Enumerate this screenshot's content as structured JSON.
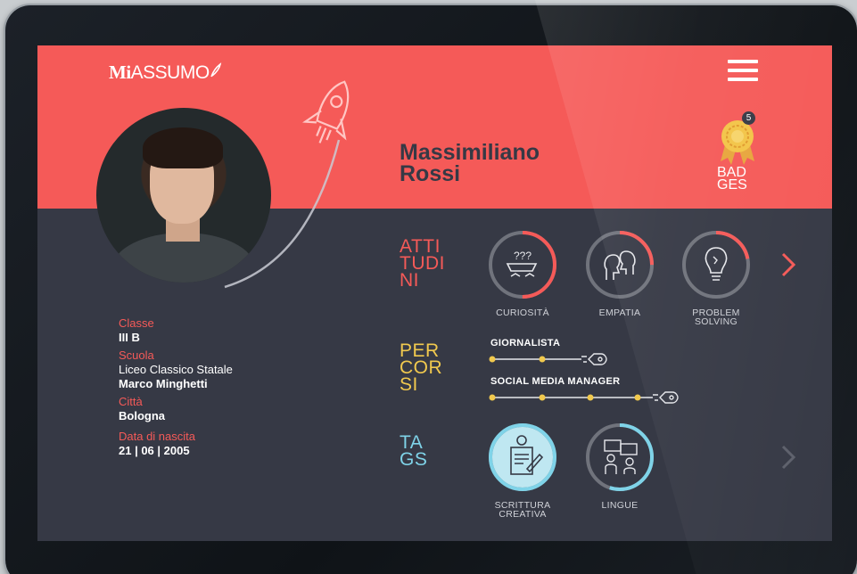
{
  "app": {
    "logo_bold": "Mi",
    "logo_light": "ASSUMO"
  },
  "profile": {
    "name_line1": "Massimiliano",
    "name_line2": "Rossi",
    "badges": {
      "count": "5",
      "label_line1": "BAD",
      "label_line2": "GES"
    },
    "info": {
      "class_label": "Classe",
      "class_value": "III B",
      "school_label": "Scuola",
      "school_value_line1": "Liceo Classico Statale",
      "school_value_line2": "Marco Minghetti",
      "city_label": "Città",
      "city_value": "Bologna",
      "birth_label": "Data di nascita",
      "birth_value": "21 | 06 | 2005"
    }
  },
  "attitudini": {
    "label_lines": [
      "ATTI",
      "TUDI",
      "NI"
    ],
    "items": [
      {
        "label": "CURIOSITÀ",
        "icon": "curiosity-icon",
        "progress": 0.5
      },
      {
        "label": "EMPATIA",
        "icon": "empathy-icon",
        "progress": 0.25
      },
      {
        "label_line1": "PROBLEM",
        "label_line2": "SOLVING",
        "icon": "problem-solving-icon",
        "progress": 0.22
      }
    ]
  },
  "percorsi": {
    "label_lines": [
      "PER",
      "COR",
      "SI"
    ],
    "items": [
      {
        "title": "GIORNALISTA",
        "steps_done": 2
      },
      {
        "title": "SOCIAL MEDIA MANAGER",
        "steps_done": 4
      }
    ]
  },
  "tags": {
    "label_lines": [
      "TA",
      "GS"
    ],
    "items": [
      {
        "label_line1": "SCRITTURA",
        "label_line2": "CREATIVA",
        "icon": "creative-writing-icon",
        "progress": 1.0
      },
      {
        "label": "LINGUE",
        "icon": "languages-icon",
        "progress": 0.55
      }
    ]
  },
  "colors": {
    "accent": "#f55a58",
    "dark": "#363945",
    "yellow": "#f1c94e",
    "cyan": "#7fd3e8"
  }
}
